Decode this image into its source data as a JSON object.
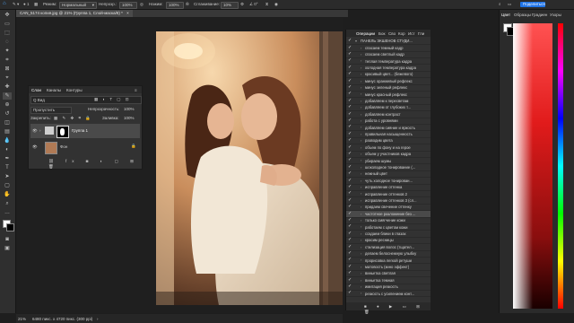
{
  "app": {
    "name": "Adobe Photoshop"
  },
  "topbar": {
    "mode_label": "Режим:",
    "mode_value": "Нормальный",
    "opacity_label": "Непрозр.:",
    "opacity_value": "100%",
    "flow_label": "Нажим:",
    "flow_value": "100%",
    "smoothing_label": "Сглаживание:",
    "smoothing_value": "10%",
    "share_button": "Поделиться"
  },
  "document_tab": {
    "title": "CAN_5174 копия.jpg @ 21% (Группа 1, Слой-маска/8) *"
  },
  "layers_panel": {
    "tabs": [
      "Слои",
      "Каналы",
      "Контуры"
    ],
    "filter_label": "Q Вид",
    "blend_mode": "Пропустить",
    "opacity_label": "Непрозрачность:",
    "opacity_value": "100%",
    "lock_label": "Закрепить:",
    "fill_label": "Заливка:",
    "fill_value": "100%",
    "layers": [
      {
        "name": "Группа 1",
        "type": "group"
      },
      {
        "name": "Фон",
        "type": "background"
      }
    ]
  },
  "actions_panel": {
    "tabs": [
      "Операции",
      "Бок",
      "Сво",
      "Кор",
      "Ист",
      "Гли"
    ],
    "set_name": "ПАНЕЛЬ ЭКШЕНОВ СТУДИ...",
    "items": [
      "спасаем темный кадр",
      "спасаем светлый кадр",
      "теплая температура кадра",
      "холодная температура кадра",
      "красивый цвет... (бежевого)",
      "минус оранжевый рефлекс",
      "минус зеленый рефлекс",
      "минус красный рефлекс",
      "добавляем к пересветам",
      "добавляем от глубоких т...",
      "добавляем контраст",
      "работа с уровнями",
      "добавляем сияние и яркость",
      "правильная насыщенность",
      "разводим цвета",
      "объем по фону и на герое",
      "объем у участников кадра",
      "убираем шумы",
      "шоколадное тонирование (...",
      "нежный цвет",
      "чуть холодное тонирован...",
      "исправление оттенка",
      "исправление оттенков 2",
      "исправление оттенков 3 (сл...",
      "придаем свечение оттенку",
      "частотное разложение без ...",
      "только смягчение кожи",
      "работаем с цветом кожи",
      "создаем блики в глазах",
      "красим ресницы",
      "стилизация волос (тщател...",
      "делаем белоснежную улыбку",
      "прорисовка легкой ретуши",
      "матовость (кино эффект)",
      "виньетка светлая",
      "виньетка темная",
      "имитация резкость",
      "резкость с усилением конт..."
    ]
  },
  "right_panel": {
    "tabs": [
      "Цвет",
      "Образцы",
      "Градиен",
      "Узоры"
    ]
  },
  "status_bar": {
    "zoom": "21%",
    "doc_info": "6480 пикс. x 4720 пикс. (300 ppi)"
  }
}
